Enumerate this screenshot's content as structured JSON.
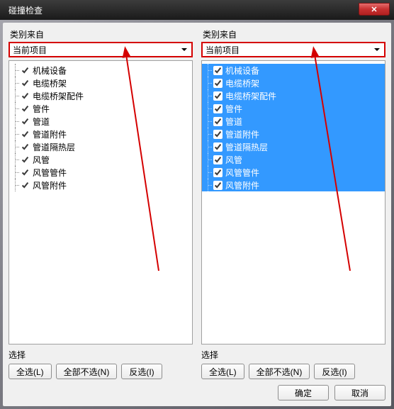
{
  "window": {
    "title": "碰撞检查"
  },
  "left": {
    "label": "类别来自",
    "dropdown_value": "当前项目",
    "items": [
      {
        "label": "机械设备",
        "checked": true
      },
      {
        "label": "电缆桥架",
        "checked": true
      },
      {
        "label": "电缆桥架配件",
        "checked": true
      },
      {
        "label": "管件",
        "checked": true
      },
      {
        "label": "管道",
        "checked": true
      },
      {
        "label": "管道附件",
        "checked": true
      },
      {
        "label": "管道隔热层",
        "checked": true
      },
      {
        "label": "风管",
        "checked": true
      },
      {
        "label": "风管管件",
        "checked": true
      },
      {
        "label": "风管附件",
        "checked": true
      }
    ]
  },
  "right": {
    "label": "类别来自",
    "dropdown_value": "当前项目",
    "items": [
      {
        "label": "机械设备",
        "checked": true
      },
      {
        "label": "电缆桥架",
        "checked": true
      },
      {
        "label": "电缆桥架配件",
        "checked": true
      },
      {
        "label": "管件",
        "checked": true
      },
      {
        "label": "管道",
        "checked": true
      },
      {
        "label": "管道附件",
        "checked": true
      },
      {
        "label": "管道隔热层",
        "checked": true
      },
      {
        "label": "风管",
        "checked": true
      },
      {
        "label": "风管管件",
        "checked": true
      },
      {
        "label": "风管附件",
        "checked": true
      }
    ]
  },
  "selection": {
    "label": "选择",
    "select_all": "全选(L)",
    "select_none": "全部不选(N)",
    "invert": "反选(I)"
  },
  "footer": {
    "ok": "确定",
    "cancel": "取消"
  }
}
